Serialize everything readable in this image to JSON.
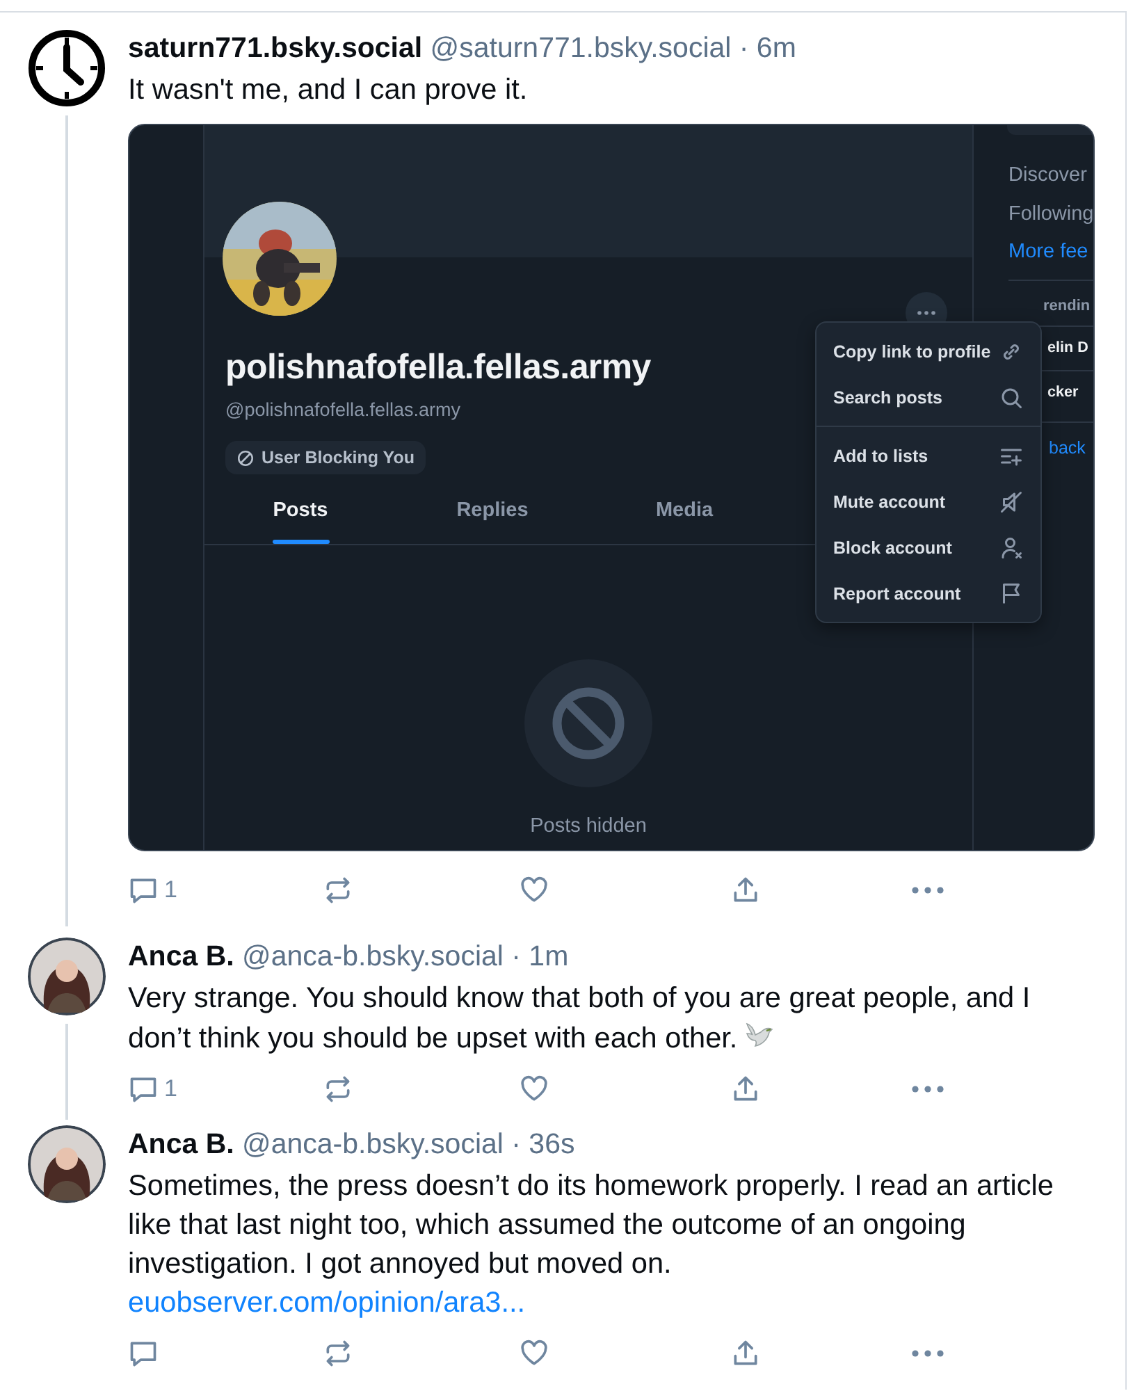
{
  "posts": [
    {
      "avatar": {
        "kind": "clock"
      },
      "name": "saturn771.bsky.social",
      "meta": "@saturn771.bsky.social · 6m",
      "text": "It wasn't me, and I can prove it.",
      "dove": false,
      "thread_line": true,
      "embed": {
        "kind": "screenshot",
        "profile_name": "polishnafofella.fellas.army",
        "profile_handle": "@polishnafofella.fellas.army",
        "badge": "User Blocking You",
        "tabs": [
          {
            "label": "Posts",
            "selected": true
          },
          {
            "label": "Replies",
            "selected": false
          },
          {
            "label": "Media",
            "selected": false
          }
        ],
        "empty_text": "Posts hidden",
        "menu": [
          [
            {
              "label": "Copy link to profile",
              "kind": "link"
            },
            {
              "label": "Search posts",
              "kind": "search"
            }
          ],
          [
            {
              "label": "Add to lists",
              "kind": "list"
            },
            {
              "label": "Mute account",
              "kind": "mute"
            },
            {
              "label": "Block account",
              "kind": "block"
            },
            {
              "label": "Report account",
              "kind": "flag"
            }
          ]
        ],
        "sidebar": [
          {
            "label": "Discover",
            "kind": "plain"
          },
          {
            "label": "Following",
            "kind": "plain"
          },
          {
            "label": "More fee",
            "kind": "link"
          },
          {
            "kind": "divider"
          },
          {
            "label": "rendin",
            "kind": "heading"
          },
          {
            "label": "elin D",
            "kind": "item"
          },
          {
            "label": "cker",
            "kind": "item"
          },
          {
            "kind": "divider"
          },
          {
            "label": "back",
            "kind": "link"
          }
        ]
      },
      "actions": {
        "reply_count": "1"
      }
    },
    {
      "avatar": {
        "kind": "person"
      },
      "name": "Anca B.",
      "meta": "@anca-b.bsky.social · 1m",
      "text": "Very strange. You should know that both of you are great people, and I don’t think you should be upset with each other.",
      "dove": true,
      "thread_line": true,
      "actions": {
        "reply_count": "1"
      }
    },
    {
      "avatar": {
        "kind": "person"
      },
      "name": "Anca B.",
      "meta": "@anca-b.bsky.social · 36s",
      "text": "Sometimes, the press doesn’t do its homework properly. I read an article like that last night too, which assumed the outcome of an ongoing investigation. I got annoyed but moved on.",
      "link": "euobserver.com/opinion/ara3...",
      "dove": false,
      "thread_line": false
    }
  ]
}
